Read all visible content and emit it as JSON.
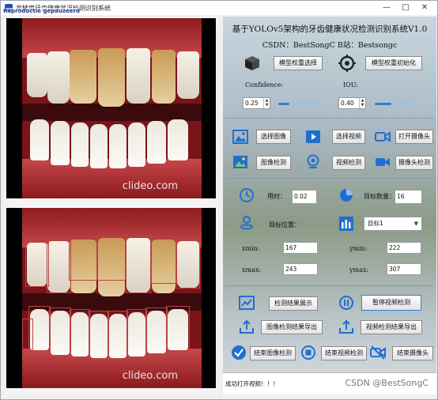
{
  "window": {
    "title": "高精度牙齿健康状况检测识别系统",
    "overlay_tag": "Reproductie gepauzeerd",
    "controls": [
      "—",
      "□",
      "✕"
    ]
  },
  "left": {
    "watermark_top": "clideo.com",
    "watermark_bottom": "clideo.com"
  },
  "header": {
    "title": "基于YOLOv5架构的牙齿健康状况检测识别系统V1.0",
    "subtitle": "CSDN：BestSongC   B站：Bestsongc"
  },
  "model": {
    "select_weights_label": "模型权重选择",
    "init_weights_label": "模型权重初始化",
    "confidence_label": "Confidence:",
    "confidence_value": "0.25",
    "confidence_fraction": 0.25,
    "iou_label": "IOU:",
    "iou_value": "0.40",
    "iou_fraction": 0.4
  },
  "media": {
    "select_image": "选择图像",
    "select_video": "选择视频",
    "open_camera": "打开摄像头",
    "image_detect": "图像检测",
    "video_detect": "视频检测",
    "camera_detect": "摄像头检测"
  },
  "stats": {
    "time_label": "用时：",
    "time_value": "0.02",
    "count_label": "目标数量：",
    "count_value": "16",
    "position_label": "目标位置：",
    "target_select": "目标1",
    "xmin_label": "xmin:",
    "xmin_value": "167",
    "ymin_label": "ymin:",
    "ymin_value": "222",
    "xmax_label": "xmax:",
    "xmax_value": "243",
    "ymax_label": "ymax:",
    "ymax_value": "307"
  },
  "actions": {
    "show_results": "检测结果展示",
    "pause_video": "暂停视频检测",
    "export_image": "图像检测结果导出",
    "export_video": "视频检测结果导出",
    "end_image": "结束图像检测",
    "end_video": "结束视频检测",
    "end_camera": "结束摄像头"
  },
  "status": {
    "message": "成功打开视频！！！",
    "watermark": "CSDN @BestSongC"
  },
  "colors": {
    "accent": "#2f7fd6",
    "icon_blue": "#1f6fd0"
  }
}
